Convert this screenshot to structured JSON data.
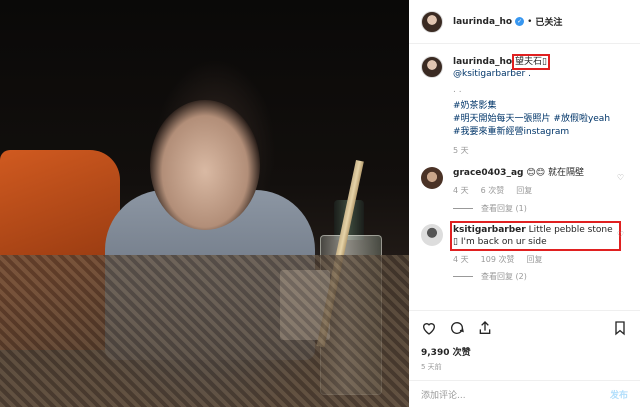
{
  "header": {
    "username": "laurinda_ho",
    "separator": "•",
    "follow_label": "已关注"
  },
  "caption": {
    "username": "laurinda_ho",
    "text": "望夫石",
    "mention": "@ksitigarbarber .",
    "dots": ". .",
    "hashtags": [
      "#奶茶影集",
      "#明天開始每天一張照片 #放假啦yeah",
      "#我要來重新經營instagram"
    ],
    "age": "5 天"
  },
  "comments": [
    {
      "username": "grace0403_ag",
      "emoji1": "😊",
      "emoji2": "😊",
      "text": "就在隔壁",
      "age": "4 天",
      "likes": "6 次赞",
      "reply": "回复",
      "view_replies": "查看回复 (1)"
    },
    {
      "username": "ksitigarbarber",
      "text": "Little pebble stone",
      "text2": "I'm back on ur side",
      "age": "4 天",
      "likes": "109 次赞",
      "reply": "回复",
      "view_replies": "查看回复 (2)"
    }
  ],
  "actions": {
    "likes": "9,390 次赞",
    "time": "5 天前"
  },
  "add_comment": {
    "placeholder": "添加评论...",
    "post": "发布"
  },
  "colors": {
    "link": "#003569",
    "verified": "#3897f0",
    "highlight": "#e02020"
  }
}
